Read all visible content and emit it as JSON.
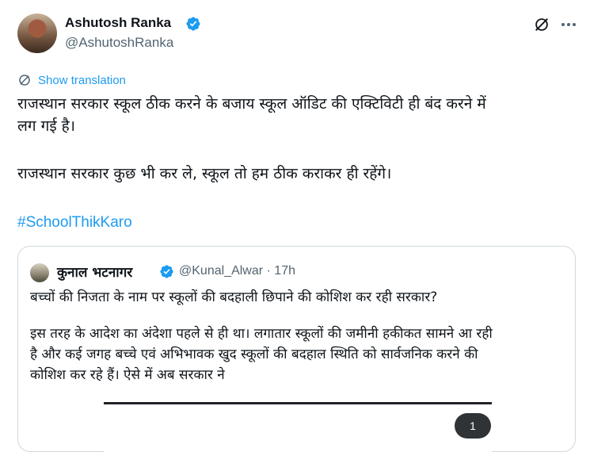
{
  "author": {
    "display_name": "Ashutosh Ranka",
    "handle": "@AshutoshRanka"
  },
  "show_translation": "Show translation",
  "tweet": {
    "line1": "राजस्थान सरकार स्कूल ठीक करने के बजाय स्कूल ऑडिट की एक्टिविटी ही बंद करने में",
    "line2": "लग गई है।",
    "line3": "राजस्थान सरकार कुछ भी कर ले, स्कूल तो हम ठीक कराकर ही रहेंगे।",
    "hashtag": "#SchoolThikKaro"
  },
  "quote": {
    "display_name": "कुनाल भटनागर",
    "handle_time": "@Kunal_Alwar · 17h",
    "line1": "बच्चों की निजता के नाम पर स्कूलों की बदहाली छिपाने की कोशिश कर रही सरकार?",
    "line2": "इस तरह के आदेश का अंदेशा पहले से ही था। लगातार स्कूलों की जमीनी हकीकत सामने आ रही",
    "line3": "है और कई जगह बच्चे एवं अभिभावक खुद स्कूलों की बदहाल स्थिति को सार्वजनिक करने की",
    "line4": "कोशिश कर रहे हैं। ऐसे में अब सरकार ने",
    "media_count": "1"
  },
  "colors": {
    "accent": "#1d9bf0",
    "text": "#0f1419",
    "secondary": "#536471",
    "border": "#cfd9de"
  },
  "icons": [
    "verified-badge-icon",
    "grok-icon",
    "more-icon",
    "translate-icon"
  ]
}
